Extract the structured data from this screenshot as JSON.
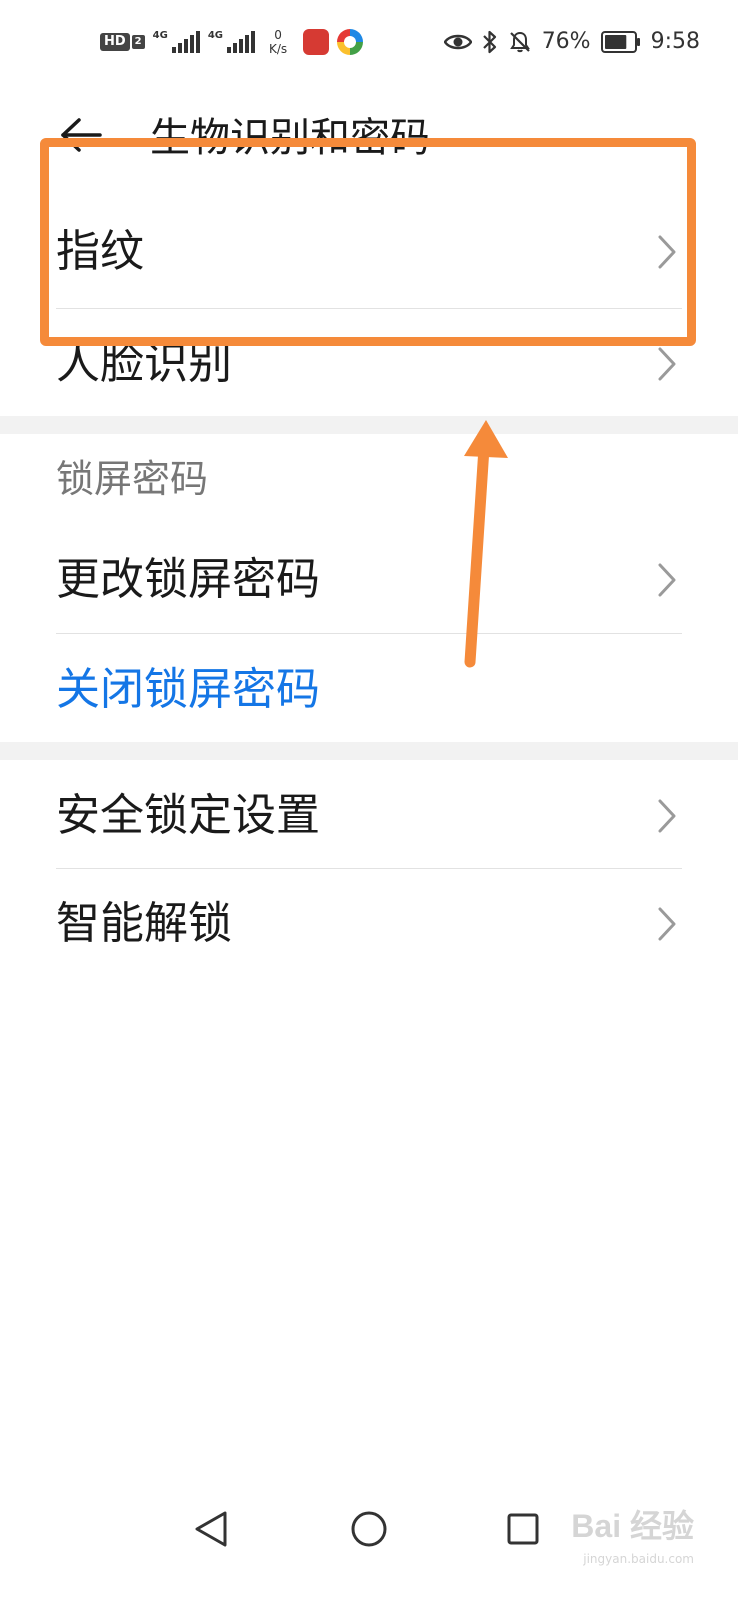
{
  "status_bar": {
    "hd_label": "HD",
    "hd_sim": "2",
    "network_1": "4G",
    "network_2": "4G",
    "speed_value": "0",
    "speed_unit": "K/s",
    "battery_percent": "76%",
    "time": "9:58",
    "battery_level": 0.76,
    "icons": [
      "hd-icon",
      "signal-icon",
      "signal-icon",
      "app-icon",
      "app-icon",
      "eye-icon",
      "bluetooth-icon",
      "mute-icon",
      "battery-icon"
    ]
  },
  "header": {
    "title": "生物识别和密码",
    "back_icon": "back-arrow-icon"
  },
  "biometrics": {
    "items": [
      {
        "label": "指纹"
      },
      {
        "label": "人脸识别"
      }
    ]
  },
  "lock_screen": {
    "section_title": "锁屏密码",
    "change_label": "更改锁屏密码",
    "disable_label": "关闭锁屏密码"
  },
  "security": {
    "items": [
      {
        "label": "安全锁定设置"
      },
      {
        "label": "智能解锁"
      }
    ]
  },
  "nav": {
    "icons": [
      "back-triangle-icon",
      "home-circle-icon",
      "recents-square-icon"
    ]
  },
  "watermark": {
    "main": "Bai 经验",
    "sub": "jingyan.baidu.com"
  },
  "colors": {
    "accent_blue": "#1476e6",
    "annotation_orange": "#f58a3a",
    "divider": "#e2e2e2",
    "section_gap": "#f2f2f2"
  }
}
